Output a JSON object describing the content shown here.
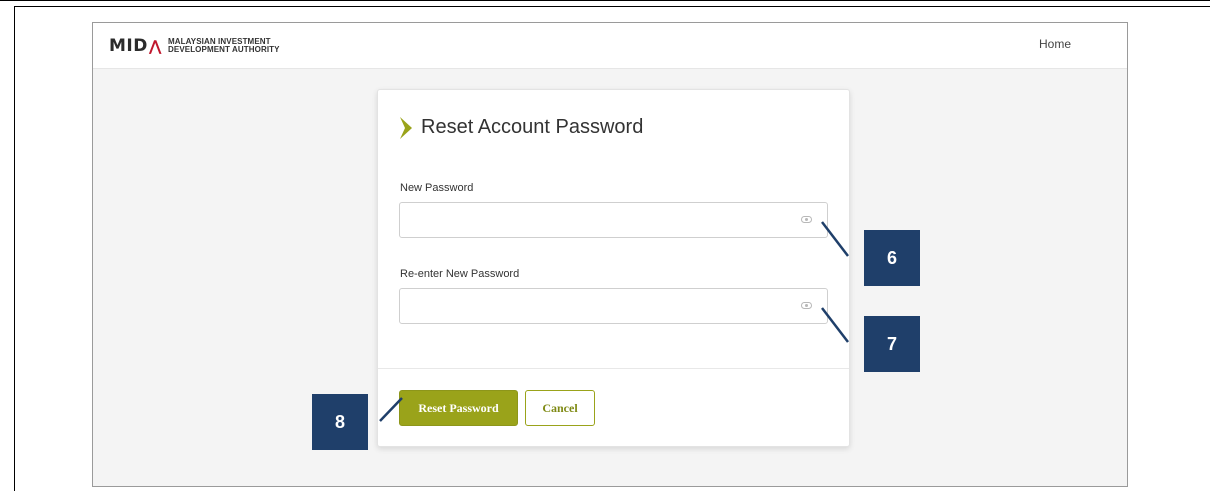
{
  "navbar": {
    "logo_mark": "MID",
    "logo_line1": "MALAYSIAN INVESTMENT",
    "logo_line2": "DEVELOPMENT AUTHORITY",
    "home_label": "Home"
  },
  "card": {
    "title": "Reset Account Password",
    "new_password_label": "New Password",
    "new_password_value": "",
    "reenter_password_label": "Re-enter New Password",
    "reenter_password_value": "",
    "reset_button_label": "Reset Password",
    "cancel_button_label": "Cancel"
  },
  "annotations": {
    "callout_6": "6",
    "callout_7": "7",
    "callout_8": "8"
  },
  "colors": {
    "accent": "#9aa31a",
    "callout": "#1f3f6a",
    "logo_red": "#c0172d"
  },
  "icons": {
    "new_password_toggle": "eye-icon",
    "reenter_password_toggle": "eye-icon",
    "title_marker": "chevron-right-icon"
  }
}
